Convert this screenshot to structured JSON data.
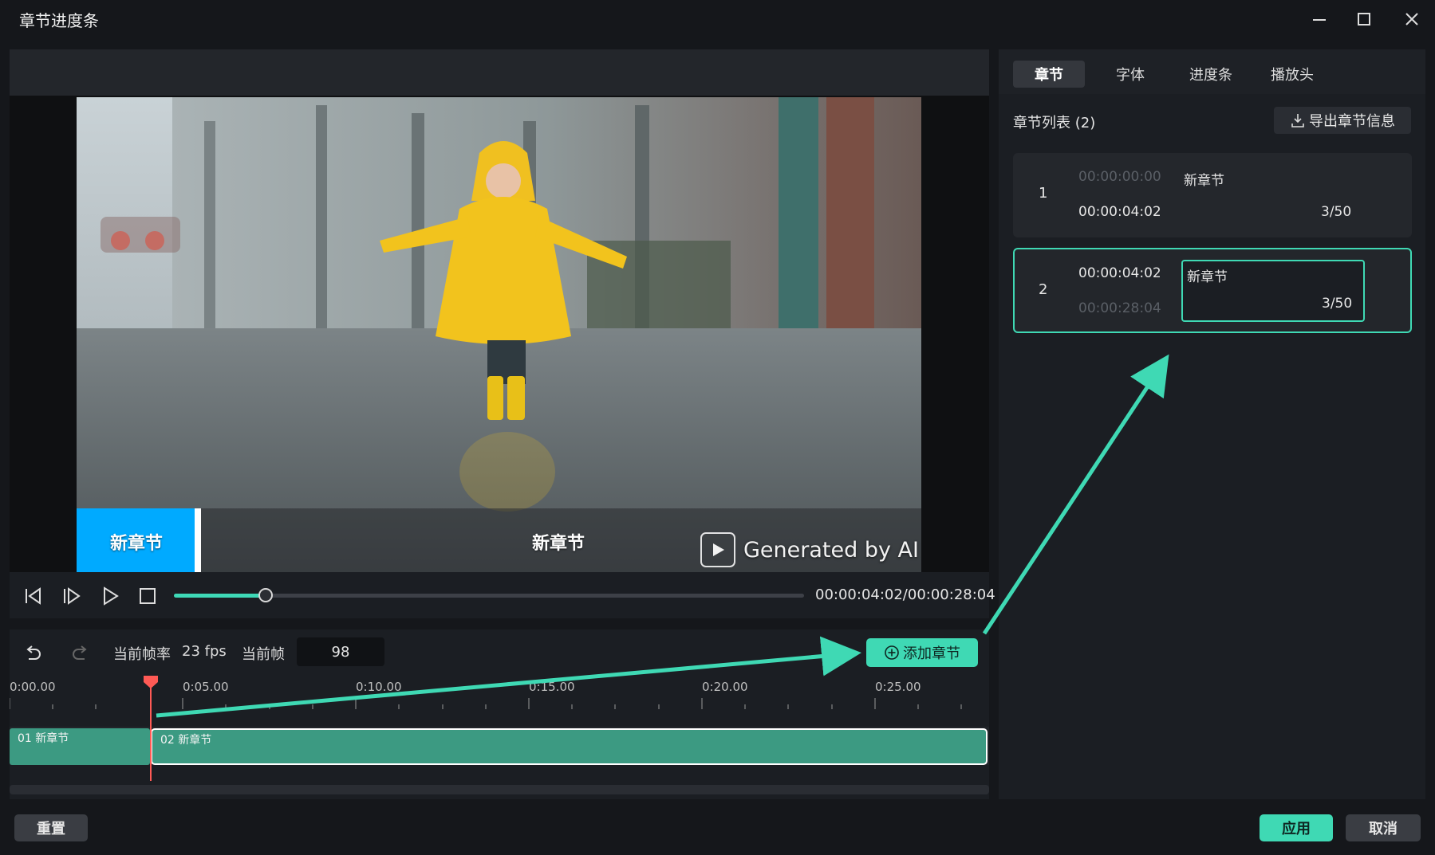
{
  "window": {
    "title": "章节进度条",
    "controls": [
      "minimize-icon",
      "maximize-icon",
      "close-icon"
    ]
  },
  "video": {
    "chapter_segments": [
      "新章节",
      "新章节"
    ],
    "watermark": "Generated by AI"
  },
  "player": {
    "timecode": "00:00:04:02/00:00:28:04",
    "progress": 0.145
  },
  "timeline": {
    "frame_rate_label": "当前帧率",
    "frame_rate_value": "23 fps",
    "frame_label": "当前帧",
    "frame_value": "98",
    "add_chapter_label": "添加章节",
    "ruler_labels": [
      "0:00.00",
      "0:05.00",
      "0:10.00",
      "0:15.00",
      "0:20.00",
      "0:25.00"
    ],
    "clips": [
      "01 新章节",
      "02 新章节"
    ]
  },
  "panel": {
    "tabs": [
      "章节",
      "字体",
      "进度条",
      "播放头"
    ],
    "active_tab": "章节",
    "list_title": "章节列表 (2)",
    "export_label": "导出章节信息",
    "chapters": [
      {
        "index": "1",
        "start": "00:00:00:00",
        "end": "00:00:04:02",
        "name": "新章节",
        "count": "3/50"
      },
      {
        "index": "2",
        "start": "00:00:04:02",
        "end": "00:00:28:04",
        "name": "新章节",
        "count": "3/50"
      }
    ]
  },
  "footer": {
    "reset_label": "重置",
    "apply_label": "应用",
    "cancel_label": "取消"
  },
  "colors": {
    "accent": "#3fd9b4",
    "chapter_active": "#00aaff",
    "playhead": "#ff5a55",
    "background": "#15171b"
  }
}
